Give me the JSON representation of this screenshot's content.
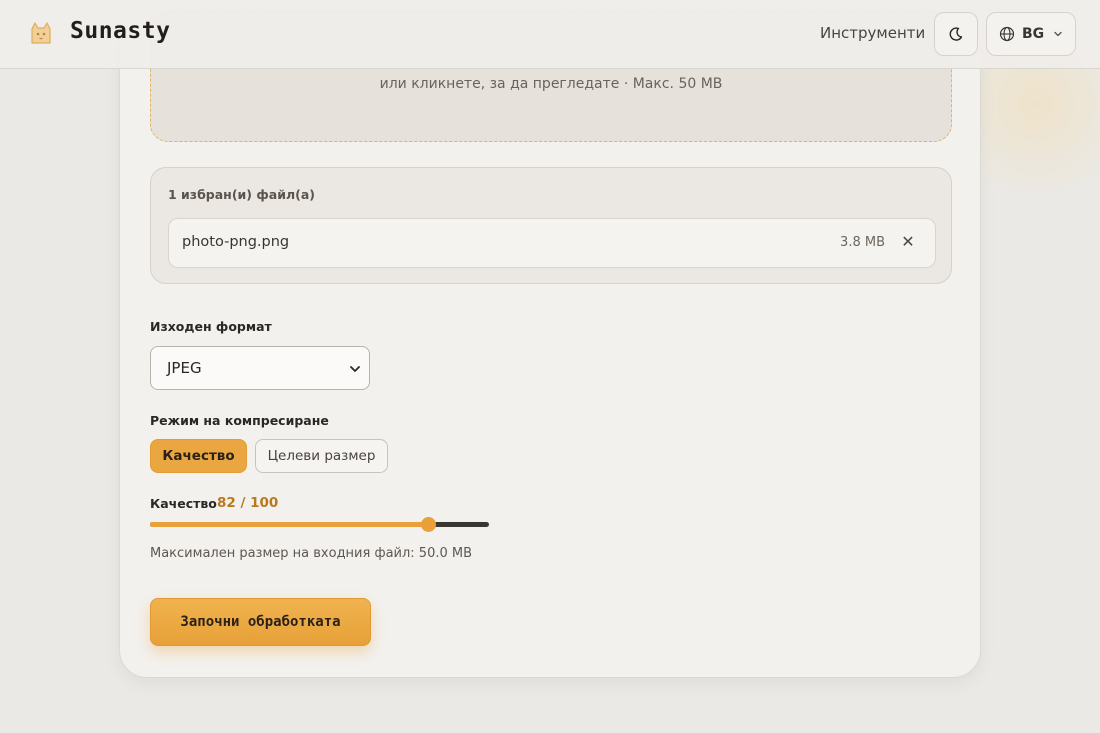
{
  "header": {
    "brand": "Sunasty",
    "nav_tools": "Инструменти",
    "theme_icon": "moon-icon",
    "language": "BG"
  },
  "dropzone": {
    "hint": "или кликнете, за да прегледате · Макс. 50 MB"
  },
  "files": {
    "count_label": "1 избран(и) файл(а)",
    "items": [
      {
        "name": "photo-png.png",
        "size": "3.8 MB"
      }
    ]
  },
  "output_format": {
    "label": "Изходен формат",
    "selected": "JPEG"
  },
  "compression": {
    "label": "Режим на компресиране",
    "modes": [
      "Качество",
      "Целеви размер"
    ],
    "active": "Качество"
  },
  "quality": {
    "label": "Качество",
    "value_text": "82 / 100",
    "value": 82,
    "max": 100
  },
  "max_input": "Максимален размер на входния файл: 50.0 MB",
  "start_button": "Започни обработката",
  "colors": {
    "accent": "#e9a03a",
    "background": "#ebe9e5",
    "card": "#f3f1ee"
  }
}
